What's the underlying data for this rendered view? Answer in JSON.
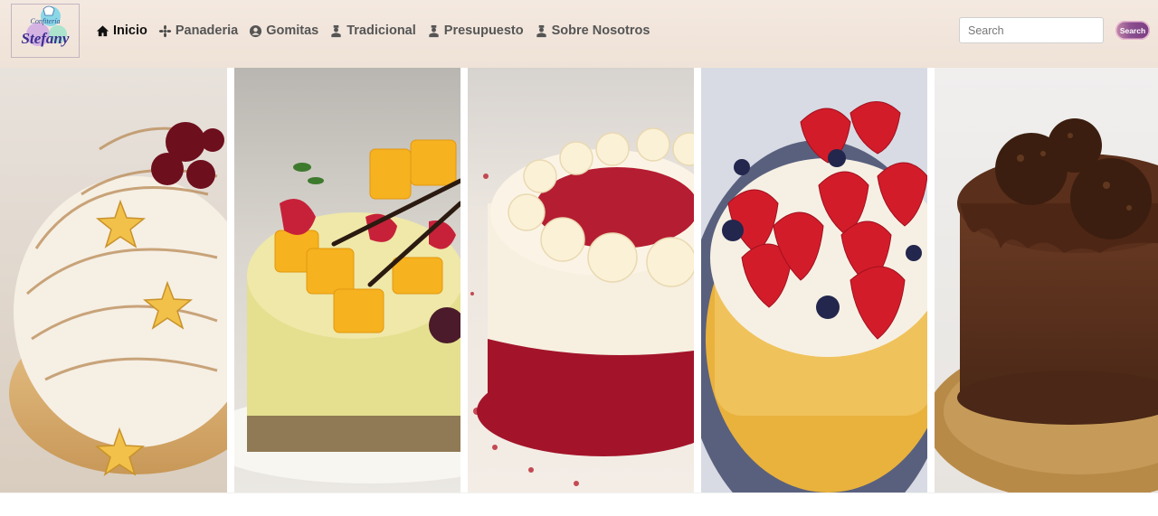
{
  "brand": {
    "line1": "Confitería",
    "line2": "Stefany"
  },
  "nav": {
    "items": [
      {
        "label": "Inicio",
        "icon": "home-icon"
      },
      {
        "label": "Panaderia",
        "icon": "flower-icon"
      },
      {
        "label": "Gomitas",
        "icon": "user-circle-icon"
      },
      {
        "label": "Tradicional",
        "icon": "baker-icon"
      },
      {
        "label": "Presupuesto",
        "icon": "baker-icon"
      },
      {
        "label": "Sobre Nosotros",
        "icon": "baker-icon"
      }
    ]
  },
  "search": {
    "placeholder": "Search",
    "button_label": "Search"
  },
  "gallery": {
    "panels": [
      {
        "name": "lemon-meringue-tart-image"
      },
      {
        "name": "mango-cheesecake-image"
      },
      {
        "name": "red-velvet-cake-image"
      },
      {
        "name": "strawberry-blueberry-tart-image"
      },
      {
        "name": "chocolate-truffle-cake-image"
      }
    ]
  },
  "colors": {
    "navbar_bg": "#efe2d7",
    "nav_text": "#555555",
    "active_text": "#111111",
    "search_button": "#7a3c82"
  }
}
